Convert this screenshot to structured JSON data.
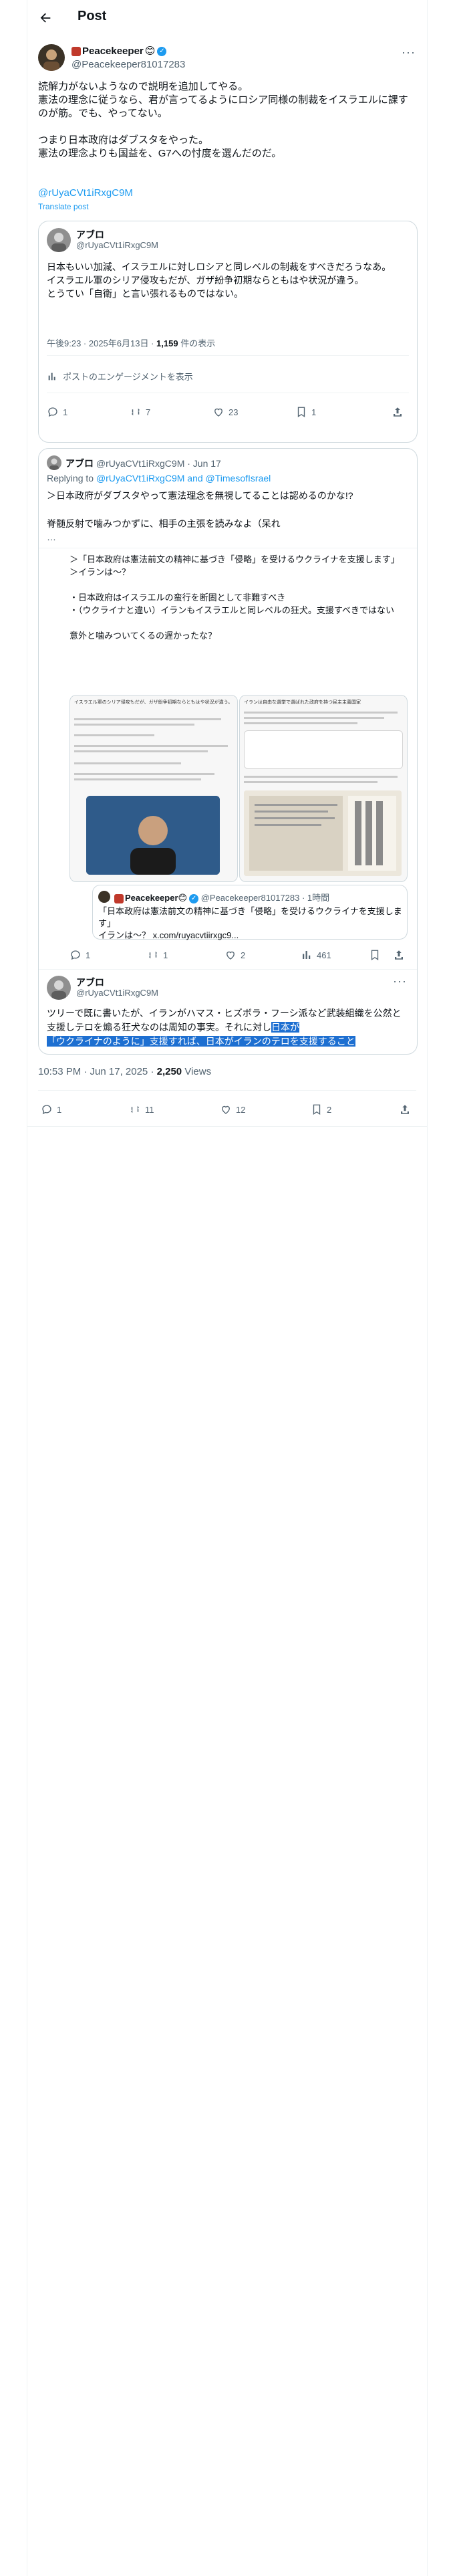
{
  "header": {
    "title": "Post"
  },
  "main_post": {
    "author_name": "Peacekeeper",
    "handle": "@Peacekeeper81017283",
    "text": "読解力がないようなので説明を追加してやる。\n憲法の理念に従うなら、君が言ってるようにロシア同様の制裁をイスラエルに課すのが筋。でも、やってない。\n\nつまり日本政府はダブスタをやった。\n憲法の理念よりも国益を、G7への忖度を選んだのだ。",
    "mention": "@rUyaCVt1iRxgC9M",
    "translate": "Translate post",
    "timestamp": "10:53 PM · Jun 17, 2025 · ",
    "views_count": "2,250",
    "views_label": " Views",
    "stats": {
      "replies": "1",
      "reposts": "11",
      "likes": "12",
      "bookmarks": "2"
    }
  },
  "quote1": {
    "author_name": "アブロ",
    "handle": "@rUyaCVt1iRxgC9M",
    "text": "日本もいい加減、イスラエルに対しロシアと同レベルの制裁をすべきだろうなあ。\nイスラエル軍のシリア侵攻もだが、ガザ紛争初期ならともはや状況が違う。\nとうてい「自衛」と言い張れるものではない。",
    "timestamp": "午後9:23 · 2025年6月13日 · ",
    "views_count": "1,159",
    "views_label": " 件の表示",
    "engagement": "ポストのエンゲージメントを表示",
    "stats": {
      "replies": "1",
      "reposts": "7",
      "likes": "23",
      "bookmarks": "1"
    }
  },
  "thread": {
    "reply1": {
      "author_name": "アブロ",
      "handle": "@rUyaCVt1iRxgC9M · Jun 17",
      "replying_prefix": "Replying to ",
      "replying_to": "@rUyaCVt1iRxgC9M and @TimesofIsrael",
      "text": "＞日本政府がダブスタやって憲法理念を無視してることは認めるのかな!?\n\n脊髄反射で噛みつかずに、相手の主張を読みなよ（呆れ",
      "more": "…"
    },
    "quote2": {
      "text": "＞「日本政府は憲法前文の精神に基づき「侵略」を受けるウクライナを支援します」\n＞イランは〜？\n\n・日本政府はイスラエルの蛮行を断固として非難すべき\n・（ウクライナと違い）イランもイスラエルと同レベルの狂犬。支援すべきではない\n\n意外と噛みついてくるの遅かったな？",
      "shot_left_title": "イスラエル軍のシリア侵攻もだが、ガザ紛争初期ならともはや状況が違う。",
      "shot_right_title": "イランは自由な選挙で選ばれた政府を持つ民主主義国家",
      "embedded_name": "Peacekeeper",
      "embedded_handle": "@Peacekeeper81017283 · 1時間",
      "embedded_text": "「日本政府は憲法前文の精神に基づき「侵略」を受けるウクライナを支援します」\nイランは〜？ x.com/ruyacvtiirxgc9...",
      "stats": {
        "replies": "1",
        "reposts": "1",
        "likes": "2",
        "views": "461"
      }
    },
    "reply2": {
      "author_name": "アブロ",
      "handle": "@rUyaCVt1iRxgC9M",
      "text_plain": "ツリーで既に書いたが、イランがハマス・ヒズボラ・フーシ派など武装組織を公然と支援しテロを煽る狂犬なのは周知の事実。それに対し",
      "text_highlight_1": "日本が",
      "text_highlight_2": "「ウクライナのように」支援すれば、日本がイランのテロを支援すること"
    }
  }
}
